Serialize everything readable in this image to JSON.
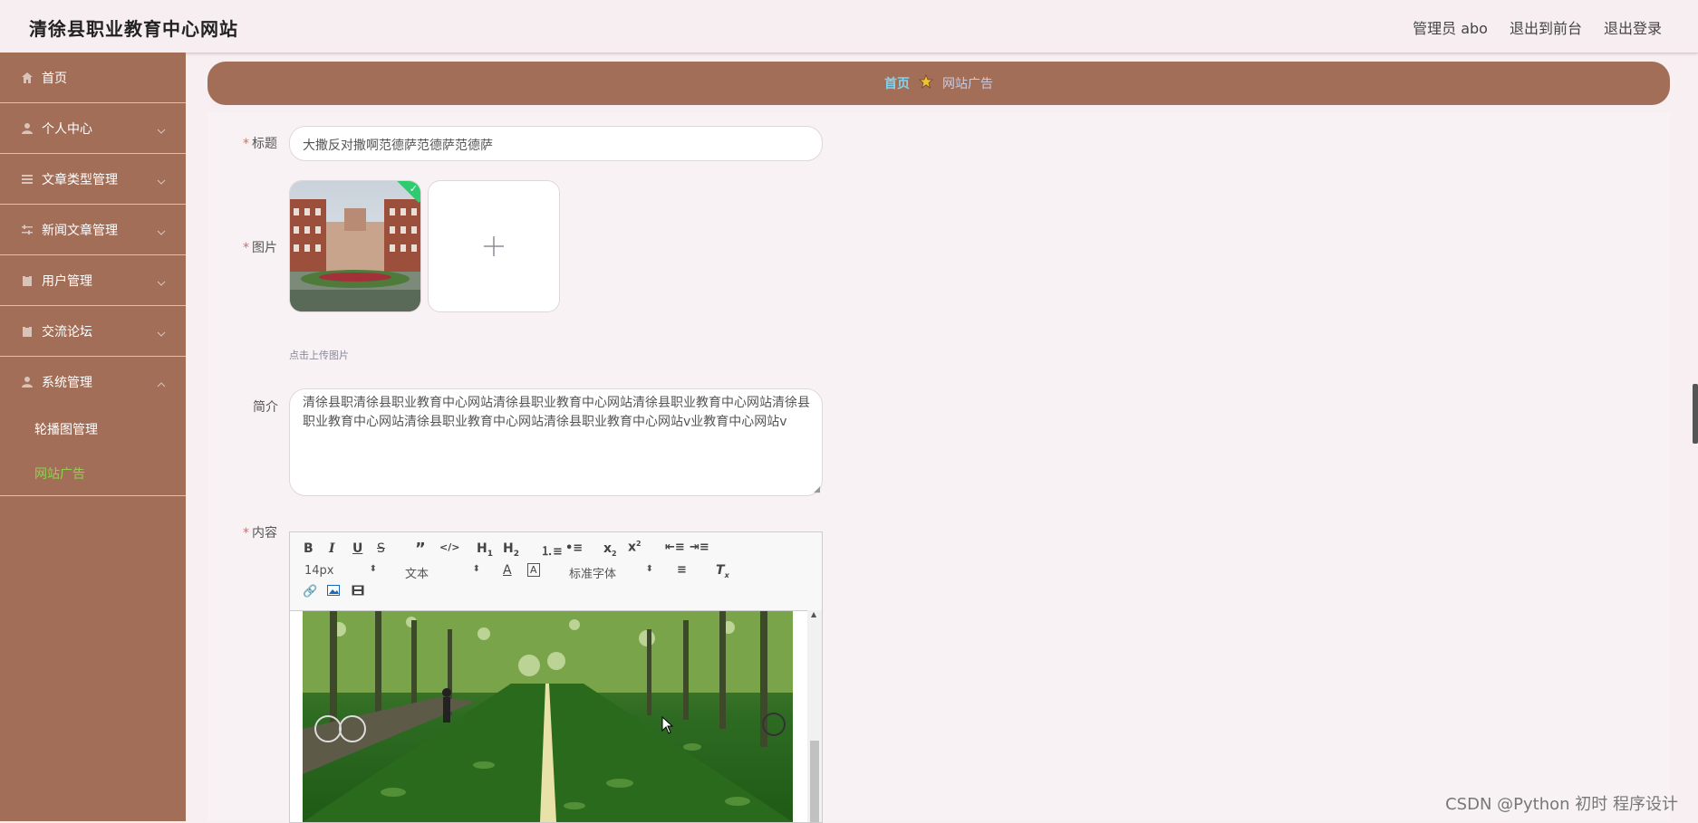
{
  "header": {
    "site_title": "清徐县职业教育中心网站",
    "admin_label": "管理员 abo",
    "back_front_label": "退出到前台",
    "logout_label": "退出登录"
  },
  "sidebar": {
    "items": [
      {
        "label": "首页",
        "icon": "home-icon"
      },
      {
        "label": "个人中心",
        "icon": "user-icon"
      },
      {
        "label": "文章类型管理",
        "icon": "list-icon"
      },
      {
        "label": "新闻文章管理",
        "icon": "sliders-icon"
      },
      {
        "label": "用户管理",
        "icon": "clipboard-icon"
      },
      {
        "label": "交流论坛",
        "icon": "clipboard-icon"
      },
      {
        "label": "系统管理",
        "icon": "user-icon"
      }
    ],
    "sub_items": [
      {
        "label": "轮播图管理",
        "active": false
      },
      {
        "label": "网站广告",
        "active": true
      }
    ],
    "active_color": "#8fd14f",
    "bg_color": "#a26e58"
  },
  "breadcrumb": {
    "home": "首页",
    "current": "网站广告"
  },
  "form": {
    "title_label": "标题",
    "title_value": "大撒反对撒啊范德萨范德萨范德萨",
    "image_label": "图片",
    "upload_hint": "点击上传图片",
    "intro_label": "简介",
    "intro_value": "清徐县职清徐县职业教育中心网站清徐县职业教育中心网站清徐县职业教育中心网站清徐县职业教育中心网站清徐县职业教育中心网站清徐县职业教育中心网站v业教育中心网站v",
    "content_label": "内容"
  },
  "editor": {
    "font_size": "14px",
    "text_style": "文本",
    "font_family": "标准字体"
  },
  "watermark": "CSDN @Python 初时 程序设计"
}
